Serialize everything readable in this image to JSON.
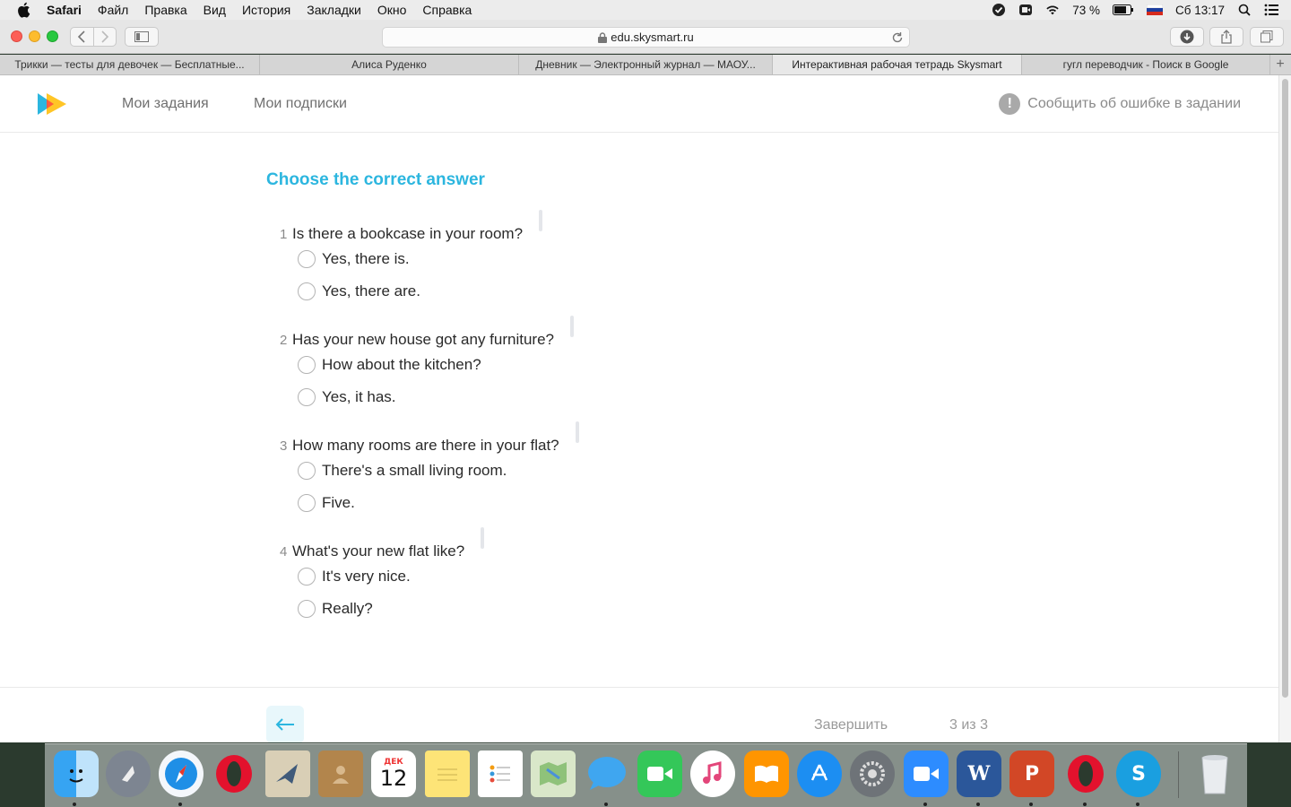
{
  "menubar": {
    "items": [
      "Safari",
      "Файл",
      "Правка",
      "Вид",
      "История",
      "Закладки",
      "Окно",
      "Справка"
    ],
    "battery": "73 %",
    "clock": "Сб 13:17"
  },
  "browser": {
    "url": "edu.skysmart.ru",
    "tabs": [
      "Трикки — тесты для девочек — Бесплатные...",
      "Алиса Руденко",
      "Дневник — Электронный журнал — МАОУ...",
      "Интерактивная рабочая тетрадь Skysmart",
      "гугл переводчик - Поиск в Google"
    ],
    "active_tab_index": 3
  },
  "site": {
    "nav": [
      "Мои задания",
      "Мои подписки"
    ],
    "report_label": "Сообщить об ошибке в задании"
  },
  "task": {
    "title": "Choose the correct answer",
    "questions": [
      {
        "num": "1",
        "text": "Is there a bookcase in your room?",
        "options": [
          "Yes, there is.",
          "Yes, there are."
        ]
      },
      {
        "num": "2",
        "text": "Has your new house got any furniture?",
        "options": [
          "How about the kitchen?",
          "Yes, it has."
        ]
      },
      {
        "num": "3",
        "text": "How many rooms are there in your flat?",
        "options": [
          "There's a small living room.",
          "Five."
        ]
      },
      {
        "num": "4",
        "text": "What's your new flat like?",
        "options": [
          "It's very nice.",
          "Really?"
        ]
      }
    ]
  },
  "footer": {
    "finish_label": "Завершить",
    "progress": "3 из 3"
  },
  "dock": {
    "calendar_month": "ДЕК",
    "calendar_day": "12",
    "apps": [
      "finder",
      "launchpad",
      "safari",
      "opera",
      "mail",
      "contacts",
      "calendar",
      "notes",
      "reminders",
      "maps",
      "messages",
      "facetime",
      "itunes",
      "books",
      "app-store",
      "system-preferences",
      "zoom",
      "word",
      "powerpoint",
      "opera",
      "skype",
      "trash"
    ]
  },
  "colors": {
    "accent": "#2cb6df",
    "text": "#2a2a2a",
    "muted": "#8a8a8a"
  }
}
